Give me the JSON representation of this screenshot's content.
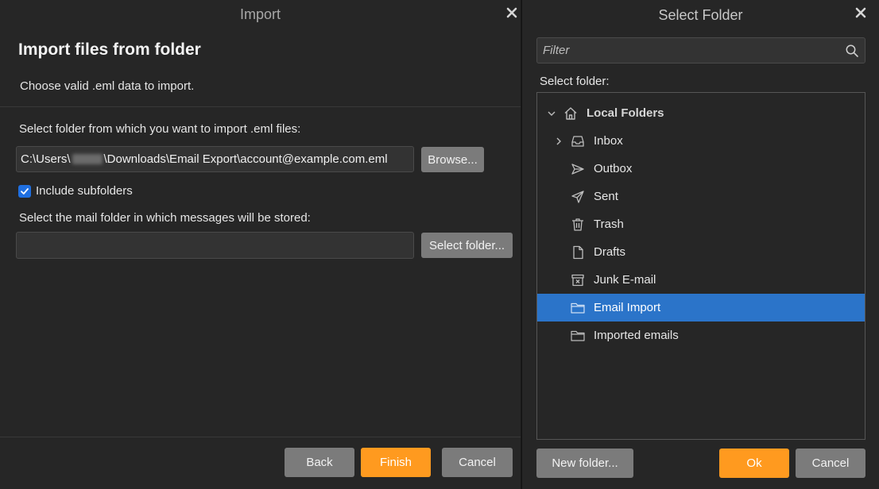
{
  "import_dialog": {
    "title": "Import",
    "heading": "Import files from folder",
    "subtitle": "Choose valid .eml data to import.",
    "source_label": "Select folder from which you want to import .eml files:",
    "path_prefix": "C:\\Users\\",
    "path_suffix": "\\Downloads\\Email Export\\account@example.com.eml",
    "browse_label": "Browse...",
    "include_subfolders_label": "Include subfolders",
    "include_subfolders_checked": true,
    "dest_label": "Select the mail folder in which messages will be stored:",
    "dest_value": "",
    "select_folder_label": "Select folder...",
    "back_label": "Back",
    "finish_label": "Finish",
    "cancel_label": "Cancel"
  },
  "folder_dialog": {
    "title": "Select Folder",
    "filter_placeholder": "Filter",
    "select_label": "Select folder:",
    "tree": [
      {
        "label": "Local Folders",
        "icon": "home-icon",
        "expanded": true
      },
      {
        "label": "Inbox",
        "icon": "inbox-icon",
        "collapsed": true
      },
      {
        "label": "Outbox",
        "icon": "outbox-icon"
      },
      {
        "label": "Sent",
        "icon": "sent-icon"
      },
      {
        "label": "Trash",
        "icon": "trash-icon"
      },
      {
        "label": "Drafts",
        "icon": "drafts-icon"
      },
      {
        "label": "Junk E-mail",
        "icon": "junk-icon"
      },
      {
        "label": "Email Import",
        "icon": "folder-icon",
        "selected": true
      },
      {
        "label": "Imported emails",
        "icon": "folder-icon"
      }
    ],
    "new_folder_label": "New folder...",
    "ok_label": "Ok",
    "cancel_label": "Cancel"
  },
  "colors": {
    "accent": "#ff9a1f",
    "selection": "#2b74c9",
    "checkbox": "#1f6fe0",
    "background": "#262626"
  }
}
